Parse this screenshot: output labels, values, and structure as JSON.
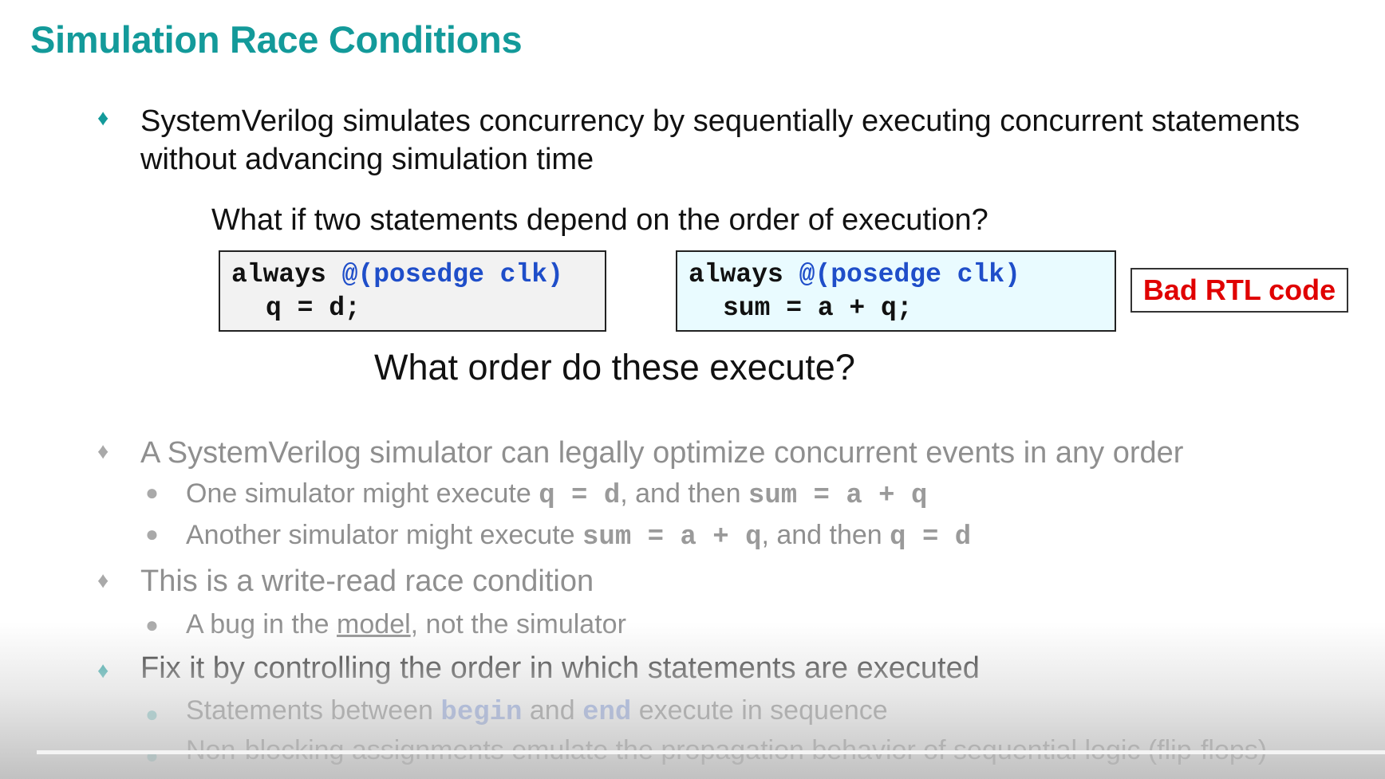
{
  "slide": {
    "title": "Simulation Race Conditions",
    "bullet1": {
      "line1": "SystemVerilog simulates concurrency by sequentially executing concurrent statements",
      "line2": "without advancing simulation time"
    },
    "question": "What if two statements depend on the order of execution?",
    "code_left": {
      "kw": "always",
      "event": "@(posedge clk)",
      "stmt": "q = d;"
    },
    "code_right": {
      "kw": "always",
      "event": "@(posedge clk)",
      "stmt": "sum = a + q;"
    },
    "badge": "Bad RTL code",
    "order_question": "What order do these execute?",
    "bullet2": {
      "text": "A SystemVerilog simulator can legally optimize concurrent events in any order",
      "sub1": {
        "pre": "One simulator might execute ",
        "code1": "q = d",
        "mid": ", and then ",
        "code2": "sum = a + q"
      },
      "sub2": {
        "pre": "Another simulator might execute ",
        "code1": "sum = a + q",
        "mid": ", and then ",
        "code2": "q = d"
      }
    },
    "bullet3": {
      "text": "This is a write-read race condition",
      "sub1": {
        "pre": "A bug in the ",
        "link": "model",
        "post": ", not the simulator"
      }
    },
    "bullet4": {
      "text": "Fix it by controlling the order in which statements are executed",
      "sub1": {
        "pre": "Statements between ",
        "code1": "begin",
        "mid": " and ",
        "code2": "end",
        "post": " execute in sequence"
      },
      "sub2": "Non-blocking assignments emulate the propagation behavior of sequential logic (flip-flops)"
    }
  },
  "colors": {
    "title": "#139a9a",
    "code_blue": "#1f4ec9",
    "badge_red": "#e00000",
    "dim_text": "#8f8f8f"
  }
}
